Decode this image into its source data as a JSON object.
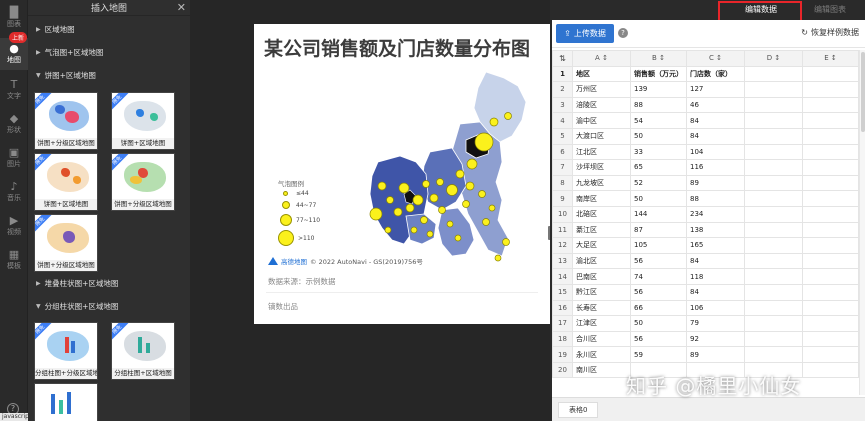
{
  "rail": {
    "items": [
      {
        "label": "图表",
        "icon": "bar-chart-icon"
      },
      {
        "label": "地图",
        "icon": "map-pin-icon"
      },
      {
        "label": "文字",
        "icon": "text-icon"
      },
      {
        "label": "形状",
        "icon": "shape-icon"
      },
      {
        "label": "图片",
        "icon": "image-icon"
      },
      {
        "label": "音乐",
        "icon": "music-icon"
      },
      {
        "label": "视频",
        "icon": "video-icon"
      },
      {
        "label": "模板",
        "icon": "template-icon"
      }
    ],
    "badge": "上新",
    "help": "?",
    "status_url": "javascript:void(0)"
  },
  "panel": {
    "title": "插入地图",
    "sections": [
      {
        "label": "区域地图",
        "expanded": false
      },
      {
        "label": "气泡图+区域地图",
        "expanded": false
      },
      {
        "label": "饼图+区域地图",
        "expanded": true
      },
      {
        "label": "堆叠柱状图+区域地图",
        "expanded": false
      },
      {
        "label": "分组柱状图+区域地图",
        "expanded": true
      }
    ],
    "vip_label": "限免",
    "thumbs": [
      {
        "caption": "饼图+分级区域地图"
      },
      {
        "caption": "饼图+区域地图"
      },
      {
        "caption": "饼图+区域地图"
      },
      {
        "caption": "饼图+分级区域地图"
      },
      {
        "caption": "饼图+分级区域地图"
      },
      {
        "caption": "分组柱图+分级区域地图"
      },
      {
        "caption": "分组柱图+区域地图"
      },
      {
        "caption": ""
      }
    ]
  },
  "chart": {
    "title": "某公司销售额及门店数量分布图",
    "legend_title": "气泡图例",
    "legend": [
      "≤44",
      "44~77",
      "77~110",
      ">110"
    ],
    "attribution": "© 2022 AutoNavi - GS(2019)756号",
    "amap_label": "高德地图",
    "source": "数据来源：示例数据",
    "brand": "镝数出品"
  },
  "editor": {
    "tabs": {
      "edit_data": "编辑数据",
      "edit_chart": "编辑图表"
    },
    "upload": "上传数据",
    "help": "?",
    "restore": "恢复样例数据",
    "columns": [
      "A",
      "B",
      "C",
      "D",
      "E"
    ],
    "sheet_tab": "表格0"
  },
  "chart_data": {
    "type": "table",
    "headers": [
      "地区",
      "销售额（万元）",
      "门店数（家）"
    ],
    "rows": [
      [
        "万州区",
        "139",
        "127"
      ],
      [
        "涪陵区",
        "88",
        "46"
      ],
      [
        "渝中区",
        "54",
        "84"
      ],
      [
        "大渡口区",
        "50",
        "84"
      ],
      [
        "江北区",
        "33",
        "104"
      ],
      [
        "沙坪坝区",
        "65",
        "116"
      ],
      [
        "九龙坡区",
        "52",
        "89"
      ],
      [
        "南岸区",
        "50",
        "88"
      ],
      [
        "北碚区",
        "144",
        "234"
      ],
      [
        "綦江区",
        "87",
        "138"
      ],
      [
        "大足区",
        "105",
        "165"
      ],
      [
        "渝北区",
        "56",
        "84"
      ],
      [
        "巴南区",
        "74",
        "118"
      ],
      [
        "黔江区",
        "56",
        "84"
      ],
      [
        "长寿区",
        "66",
        "106"
      ],
      [
        "江津区",
        "50",
        "79"
      ],
      [
        "合川区",
        "56",
        "92"
      ],
      [
        "永川区",
        "59",
        "89"
      ],
      [
        "南川区",
        "",
        ""
      ]
    ]
  },
  "watermark": "知乎 @橘里小仙女"
}
